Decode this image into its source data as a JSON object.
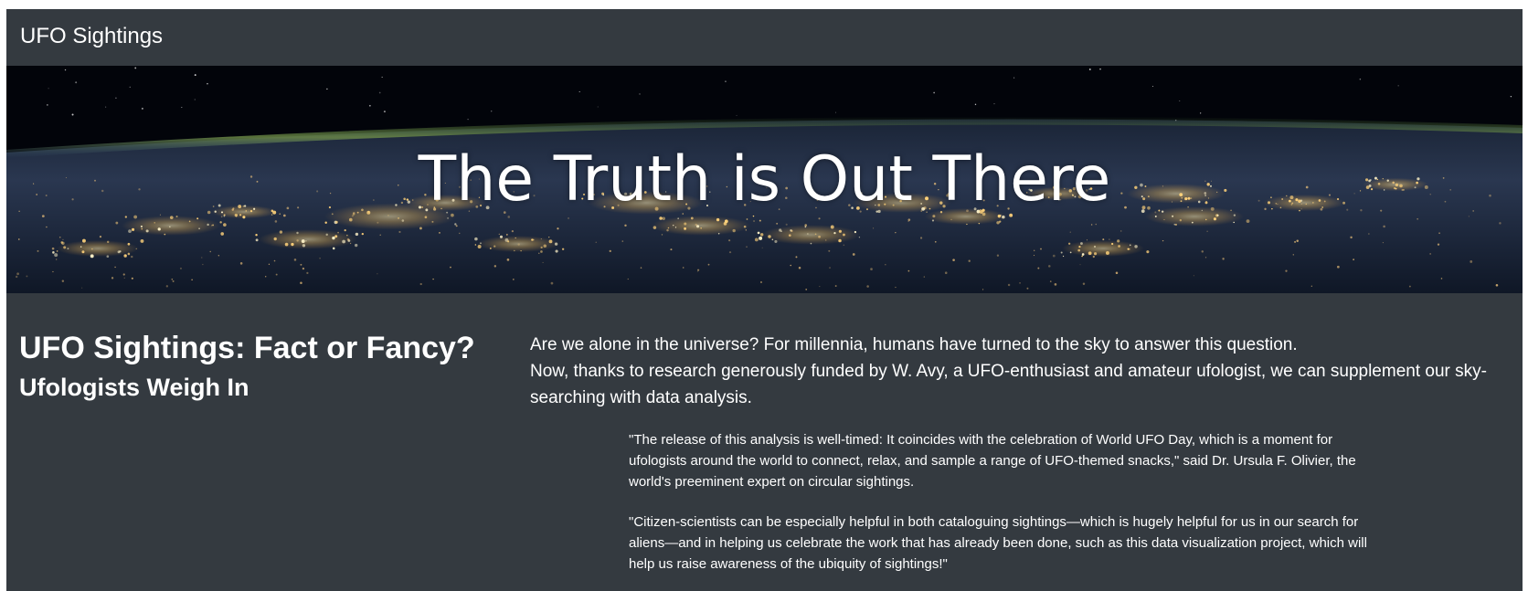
{
  "navbar": {
    "brand": "UFO Sightings"
  },
  "hero": {
    "title": "The Truth is Out There"
  },
  "intro": {
    "heading": "UFO Sightings: Fact or Fancy?",
    "subheading": "Ufologists Weigh In",
    "paragraph_line1": "Are we alone in the universe? For millennia, humans have turned to the sky to answer this question.",
    "paragraph_line2": "Now, thanks to research generously funded by W. Avy, a UFO-enthusiast and amateur ufologist, we can supplement our sky-searching with data analysis."
  },
  "quotes": [
    "\"The release of this analysis is well-timed: It coincides with the celebration of World UFO Day, which is a moment for ufologists around the world to connect, relax, and sample a range of UFO-themed snacks,\" said Dr. Ursula F. Olivier, the world's preeminent expert on circular sightings.",
    "\"Citizen-scientists can be especially helpful in both cataloguing sightings—which is hugely helpful for us in our search for aliens—and in helping us celebrate the work that has already been done, such as this data visualization project, which will help us raise awareness of the ubiquity of sightings!\""
  ],
  "colors": {
    "page_background": "#343a40",
    "text": "#ffffff",
    "hero_sky": "#03060c",
    "city_lights": "#ffd27a"
  }
}
